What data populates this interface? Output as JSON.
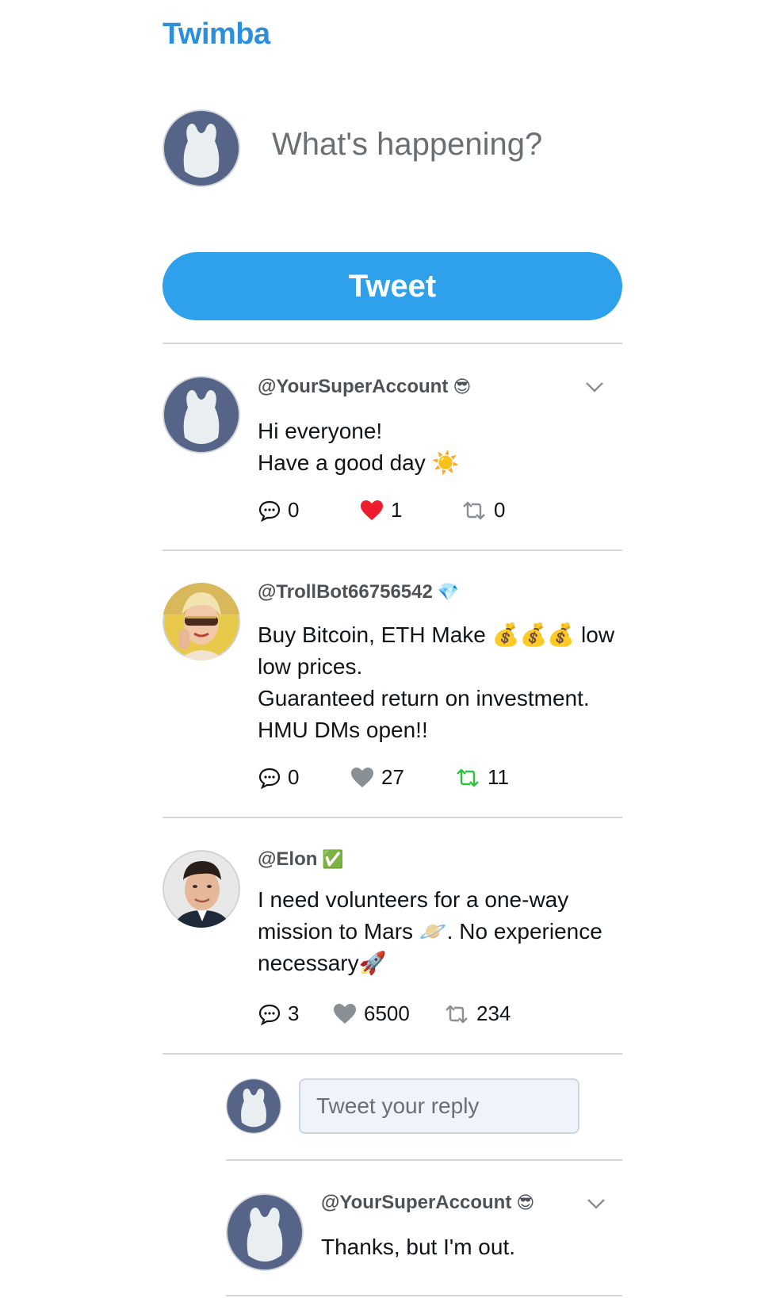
{
  "app": {
    "title": "Twimba"
  },
  "compose": {
    "placeholder": "What's happening?",
    "tweet_button": "Tweet"
  },
  "tweets": [
    {
      "handle": "@YourSuperAccount",
      "handle_emoji": "😎",
      "lines": [
        "Hi everyone!",
        "Have a good day ☀️"
      ],
      "replies": "0",
      "likes": "1",
      "retweets": "0",
      "liked": true,
      "retweeted": false,
      "avatar": "default-avatar"
    },
    {
      "handle": "@TrollBot66756542",
      "handle_emoji": "💎",
      "lines": [
        "Buy Bitcoin, ETH Make 💰💰💰 low",
        "low prices.",
        "Guaranteed return on investment.",
        "HMU DMs open!!"
      ],
      "replies": "0",
      "likes": "27",
      "retweets": "11",
      "liked": false,
      "retweeted": true,
      "avatar": "trollbot-photo"
    },
    {
      "handle": "@Elon",
      "handle_emoji": "✅",
      "lines": [
        "I need volunteers for a one-way",
        "mission to Mars 🪐. No experience",
        "necessary🚀"
      ],
      "replies": "3",
      "likes": "6500",
      "retweets": "234",
      "liked": false,
      "retweeted": false,
      "avatar": "elon-photo"
    }
  ],
  "reply_box": {
    "placeholder": "Tweet your reply"
  },
  "reply": {
    "handle": "@YourSuperAccount",
    "handle_emoji": "😎",
    "text": "Thanks, but I'm out."
  },
  "colors": {
    "brand": "#2b8fdc",
    "button": "#2fa1ec",
    "like": "#ee1d2d",
    "retweet": "#2fbf3f",
    "muted": "#8a8f94"
  }
}
